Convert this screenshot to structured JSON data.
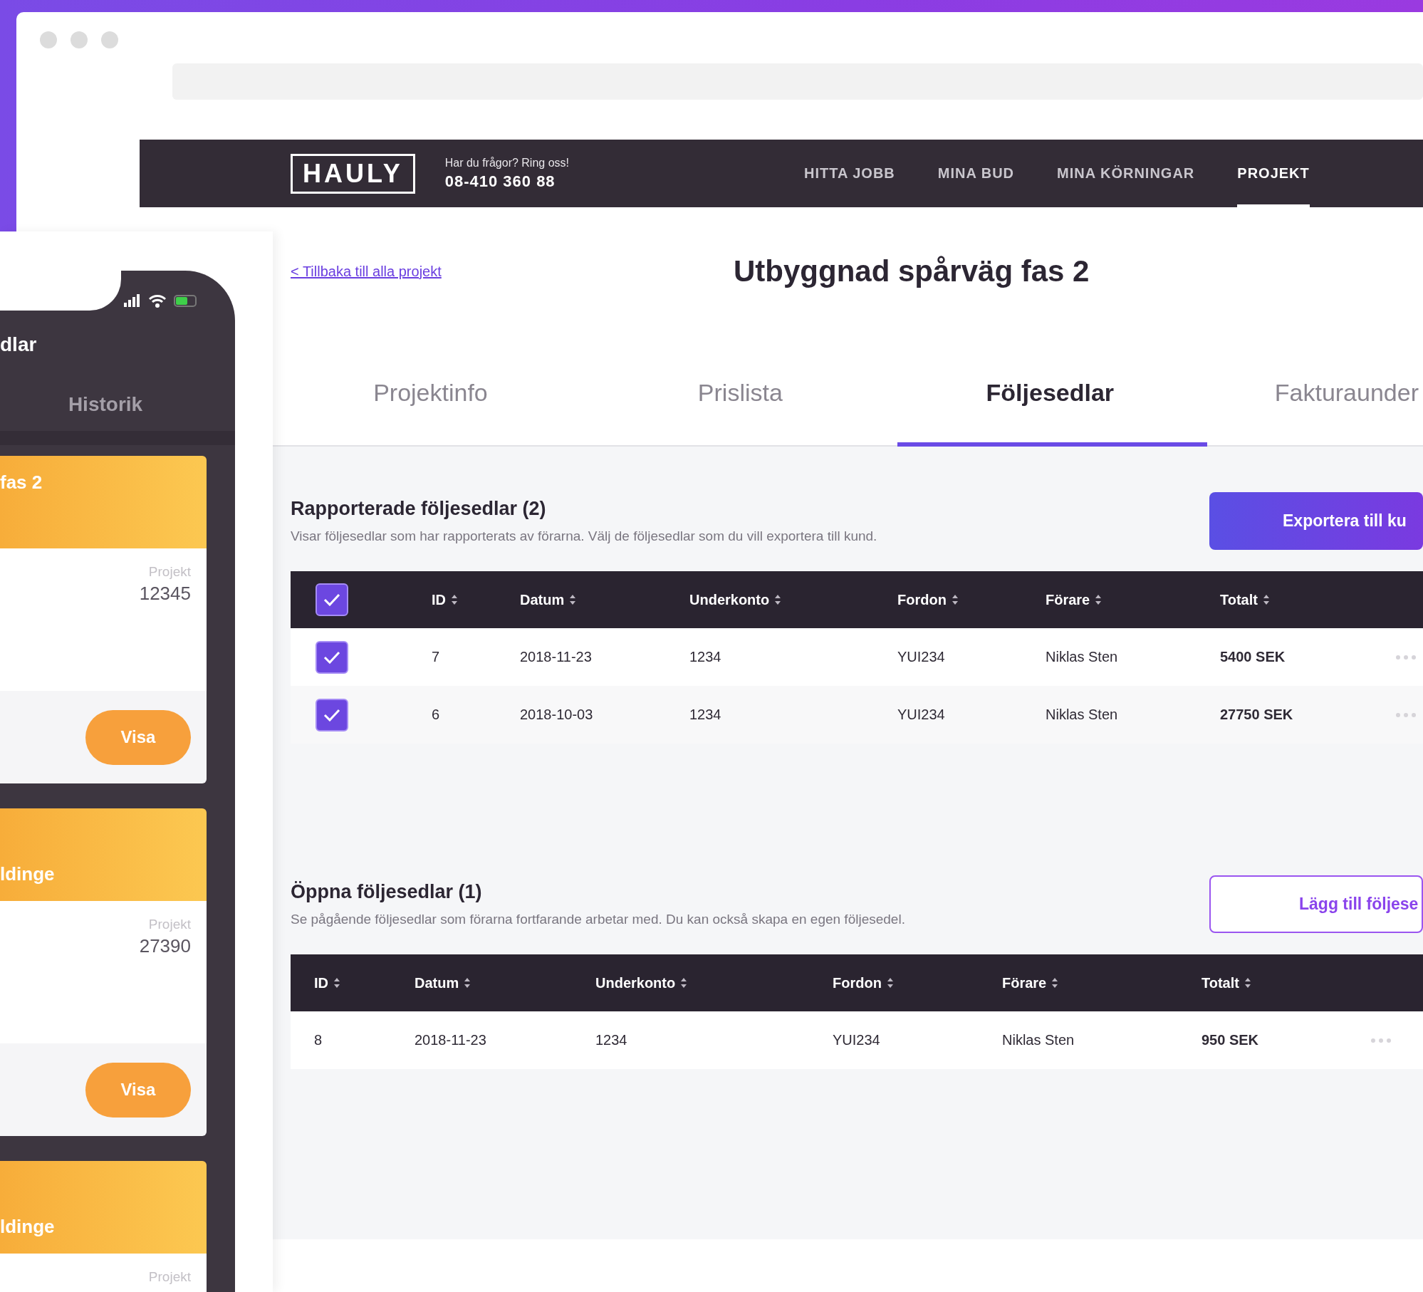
{
  "navbar": {
    "logo": "HAULY",
    "contact_prompt": "Har du frågor? Ring oss!",
    "phone": "08-410 360 88",
    "links": [
      {
        "label": "HITTA JOBB",
        "selected": false
      },
      {
        "label": "MINA BUD",
        "selected": false
      },
      {
        "label": "MINA KÖRNINGAR",
        "selected": false
      },
      {
        "label": "PROJEKT",
        "selected": true
      }
    ]
  },
  "page": {
    "back_link": "< Tillbaka till alla projekt",
    "title": "Utbyggnad spårväg fas 2",
    "tabs": [
      {
        "label": "Projektinfo",
        "selected": false
      },
      {
        "label": "Prislista",
        "selected": false
      },
      {
        "label": "Följesedlar",
        "selected": true
      },
      {
        "label": "Fakturaunder",
        "selected": false
      }
    ]
  },
  "sections": [
    {
      "heading": "Rapporterade följesedlar (2)",
      "description": "Visar följesedlar som har rapporterats av förarna. Välj de följesedlar som du vill exportera till kund.",
      "button": {
        "label": "Exportera till ku",
        "kind": "primary"
      },
      "table": {
        "select_all_checked": true,
        "columns": [
          "ID",
          "Datum",
          "Underkonto",
          "Fordon",
          "Förare",
          "Totalt"
        ],
        "rows": [
          {
            "selected": true,
            "cells": [
              "7",
              "2018-11-23",
              "1234",
              "YUI234",
              "Niklas Sten",
              "5400 SEK"
            ]
          },
          {
            "selected": true,
            "cells": [
              "6",
              "2018-10-03",
              "1234",
              "YUI234",
              "Niklas Sten",
              "27750 SEK"
            ]
          }
        ]
      }
    },
    {
      "heading": "Öppna följesedlar (1)",
      "description": "Se pågående följesedlar som förarna fortfarande arbetar med. Du kan också skapa en egen följesedel.",
      "button": {
        "label": "Lägg till följese",
        "kind": "outline"
      },
      "table": {
        "columns": [
          "ID",
          "Datum",
          "Underkonto",
          "Fordon",
          "Förare",
          "Totalt"
        ],
        "rows": [
          {
            "cells": [
              "8",
              "2018-11-23",
              "1234",
              "YUI234",
              "Niklas Sten",
              "950 SEK"
            ]
          }
        ]
      }
    }
  ],
  "phone": {
    "title": "dlar",
    "tab": "Historik",
    "cards": [
      {
        "title": "fas 2",
        "project_label": "Projekt",
        "project_number": "12345",
        "button": "Visa"
      },
      {
        "title": "ldinge",
        "project_label": "Projekt",
        "project_number": "27390",
        "button": "Visa"
      },
      {
        "title": "ldinge",
        "project_label": "Projekt"
      }
    ]
  }
}
